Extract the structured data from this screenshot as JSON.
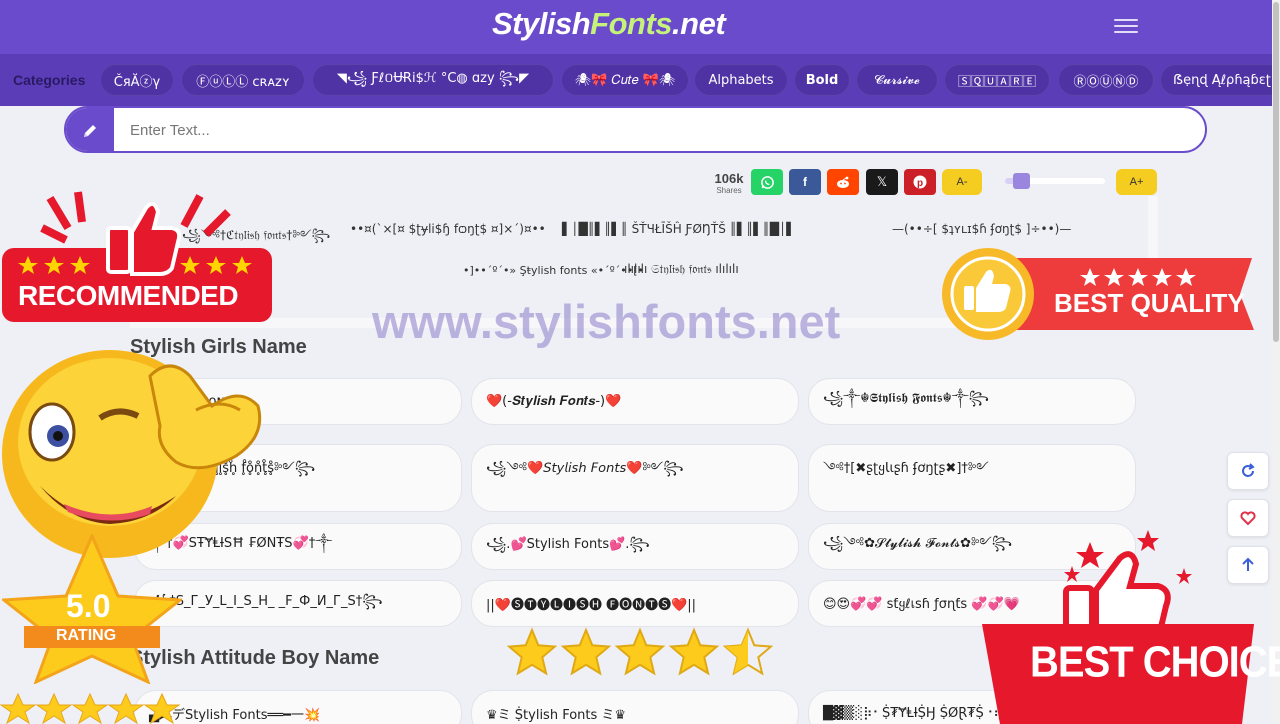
{
  "header": {
    "logo_part1": "Stylish",
    "logo_part2": "Fonts",
    "logo_part3": ".net"
  },
  "categories": {
    "label": "Categories",
    "items": [
      "ČяĂⓩγ",
      "ⒻⓤⓁⓁ ᴄʀᴀᴢʏ",
      "◥꧁ Ƒℓ០ɄɌi$ℋ °C◍ ɑzy ꧂◤",
      "🕷🎀 𝐶𝑢𝑡𝑒 🎀🕷",
      "Alphabets",
      "Bold",
      "𝓒𝓾𝓻𝓼𝓲𝓿𝓮",
      "🅂🅀🅄🄰🅁🄴",
      "ⓇⓄⓊⓃⒹ",
      "ẞẹɳɖ Ąℓρɦąɓɛʈ"
    ]
  },
  "search": {
    "placeholder": "Enter Text..."
  },
  "share": {
    "count": "106k",
    "label": "Shares",
    "whatsapp_color": "#25d366",
    "facebook_color": "#3b5998",
    "reddit_color": "#ff4500",
    "x_color": "#1a1a1a",
    "pinterest_color": "#cb2027",
    "decrease_label": "A-",
    "increase_label": "A+",
    "font_size_level": 0.1
  },
  "preview": {
    "items": [
      "꧁༺†ℭ𝔱𝔶𝔩𝔦𝔰𝔥 𝔣𝔬𝔫𝔱𝔰†༻꧂",
      "••¤(`×[¤ $ʈɏli$ɧ fѻŋʈ$ ¤]×´)¤••",
      "▌│█║▌║▌║ ŠŤЧŁĪŠĤ ƑØŊŤŠ ║▌║▌║█│▌",
      "—(••÷[ $ʇʏʟɪ$ɦ ʄơŋʈ$ ]÷••)—",
      "•]••´º´•» Şŧylish fonts «•´º´••[•",
      "ılılılı 𝔖𝔱𝔶𝔩𝔦𝔰𝔥 𝔣𝔬𝔫𝔱𝔰 ılılılı"
    ]
  },
  "watermark": "www.stylishfonts.net",
  "sections": [
    {
      "title": "Stylish Girls Name",
      "cards": [
        "ꜱᴛʏʟɪꜱʜ ꜰᴏɴᴛꜱ",
        "❤️(-𝑺𝒕𝒚𝒍𝒊𝒔𝒉 𝑭𝒐𝒏𝒕𝒔-)❤️",
        "꧁༒☬𝕾𝖙𝖞𝖑𝖎𝖘𝖍 𝕱𝖔𝖓𝖙𝖘☬༒꧂",
        "꧁༺ᵒs̥̊t̥̊ẙ̥l̥̊i̥̊s̥̊h̥̊ f̥̊o̥̊n̥̊t̥̊s̥̊༻꧂",
        "꧁༺❤️𝘚𝘵𝘺𝘭𝘪𝘴𝘩 𝘍𝘰𝘯𝘵𝘴❤️༻꧂",
        "༺†[✖ʂʈყƖɩʂɦ ʄơŋʈʂ✖]†༻",
        "༒†💞SŦɎⱠƗSĦ ₣ØNŦS💞†༒",
        "꧁.💕Stylish Fonts💕.꧂",
        "꧁༺✿𝓢𝓽𝔂𝓵𝓲𝓼𝓱 𝓕𝓸𝓷𝓽𝓼✿༻꧂",
        "꧁†S_Г_У_L_I_S_H_ _F_Ф_И_Г_S†꧂",
        "||❤️🅢🅣🅨🅛🅘🅢🅗 🅕🅞🅝🅣🅢❤️||",
        "😊😍💞💞 ꜱƭყℓเꜱɦ ƒσɳƭꜱ 💞💞💗"
      ]
    },
    {
      "title": "Stylish Attitude Boy Name",
      "cards": [
        "▄︻デStylish Fonts══━一💥",
        "♛ミ Ṩtylish Fonts ミ♛",
        "█▓▒░⡷⠂Ṩ₮ɎⱠƗṨӇ ṨØⱤ₮Ṩ⠐⢾░▒▓█"
      ]
    }
  ],
  "badges": {
    "recommended": "RECOMMENDED",
    "best_quality": "BEST QUALITY",
    "rating_value": "5.0",
    "rating_label": "RATING",
    "best_choice": "BEST CHOICE",
    "rating_stars_filled": 4.5
  }
}
